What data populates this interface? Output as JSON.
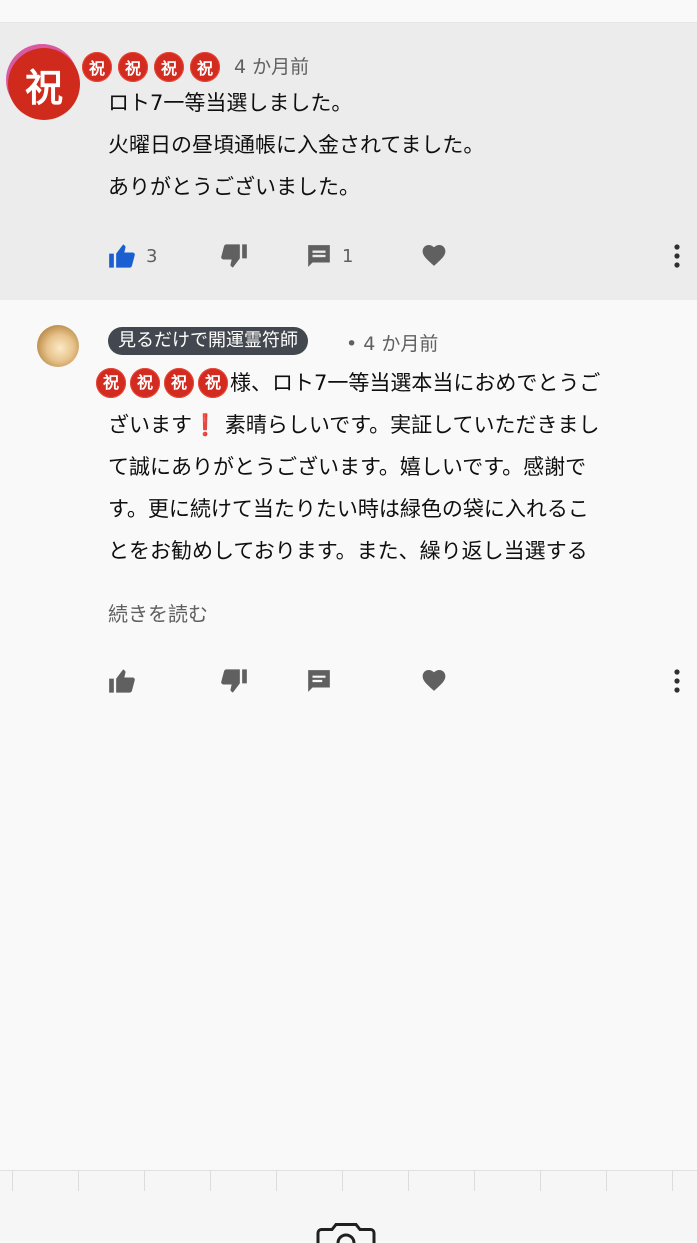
{
  "comment1": {
    "avatar_char": "祝",
    "iwai": [
      "祝",
      "祝",
      "祝",
      "祝"
    ],
    "time": "4 か月前",
    "lines": [
      "ロト7一等当選しました。",
      "火曜日の昼頃通帳に入金されてました。",
      "ありがとうございました。"
    ],
    "likes": "3",
    "replies": "1",
    "icons": [
      "thumb-up-icon",
      "thumb-down-icon",
      "comment-icon",
      "heart-icon",
      "more-vert-icon"
    ],
    "like_color": "#1a5fd1"
  },
  "comment2": {
    "author": "見るだけで開運霊符師",
    "time": "• 4 か月前",
    "iwai": [
      "祝",
      "祝",
      "祝",
      "祝"
    ],
    "lines": [
      "様、ロト7一等当選本当におめでとうご",
      "ざいます❗ 素晴らしいです。実証していただきまし",
      "て誠にありがとうございます。嬉しいです。感謝で",
      "す。更に続けて当たりたい時は緑色の袋に入れるこ",
      "とをお勧めしております。また、繰り返し当選する"
    ],
    "read_more": "続きを読む",
    "icons": [
      "thumb-up-icon",
      "thumb-down-icon",
      "comment-icon",
      "heart-icon",
      "more-vert-icon"
    ]
  },
  "bottom": {
    "icons": [
      "camera-icon"
    ]
  }
}
